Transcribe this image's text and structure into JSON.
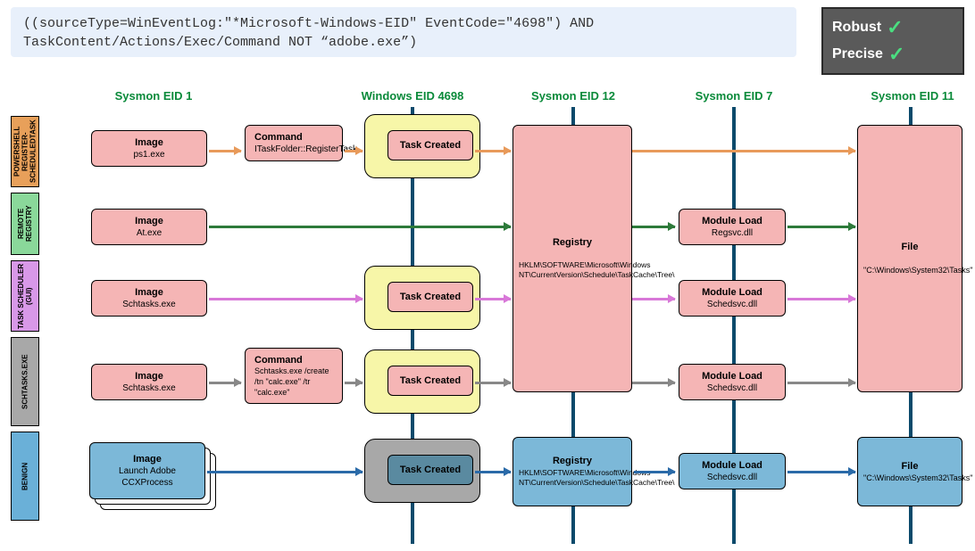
{
  "query": "((sourceType=WinEventLog:\"*Microsoft-Windows-EID\" EventCode=\"4698\")\nAND TaskContent/Actions/Exec/Command NOT “adobe.exe”)",
  "badges": {
    "robust": "Robust",
    "precise": "Precise"
  },
  "headers": {
    "c1": "Sysmon EID 1",
    "c2": "Windows EID 4698",
    "c3": "Sysmon EID 12",
    "c4": "Sysmon EID 7",
    "c5": "Sysmon EID 11"
  },
  "rows": {
    "r1": {
      "label": "POWERSHELL REGISTER-SCHEDULEDTASK",
      "color": "#e8a05a"
    },
    "r2": {
      "label": "REMOTE REGISTRY",
      "color": "#8ad89a"
    },
    "r3": {
      "label": "TASK SCHEDULER (GUI)",
      "color": "#d898e8"
    },
    "r4": {
      "label": "SCHTASKS.EXE",
      "color": "#a8a8a8"
    },
    "r5": {
      "label": "BENIGN",
      "color": "#6ab0d8"
    }
  },
  "nodes": {
    "img1": {
      "t": "Image",
      "s": "ps1.exe"
    },
    "cmd1": {
      "t": "Command",
      "s": "ITaskFolder::RegisterTask"
    },
    "img2": {
      "t": "Image",
      "s": "At.exe"
    },
    "img3": {
      "t": "Image",
      "s": "Schtasks.exe"
    },
    "img4": {
      "t": "Image",
      "s": "Schtasks.exe"
    },
    "cmd4": {
      "t": "Command",
      "s": "Schtasks.exe /create /tn \"calc.exe\" /tr \"calc.exe\""
    },
    "img5": {
      "t": "Image",
      "s": "Launch Adobe CCXProcess"
    },
    "tc": "Task Created",
    "reg": {
      "t": "Registry",
      "s": "HKLM\\SOFTWARE\\Microsoft\\Windows NT\\CurrentVersion\\Schedule\\TaskCache\\Tree\\"
    },
    "mod2": {
      "t": "Module Load",
      "s": "Regsvc.dll"
    },
    "mod3": {
      "t": "Module Load",
      "s": "Schedsvc.dll"
    },
    "mod4": {
      "t": "Module Load",
      "s": "Schedsvc.dll"
    },
    "mod5": {
      "t": "Module Load",
      "s": "Schedsvc.dll"
    },
    "file": {
      "t": "File",
      "s": "\"C:\\Windows\\System32\\Tasks\""
    }
  }
}
